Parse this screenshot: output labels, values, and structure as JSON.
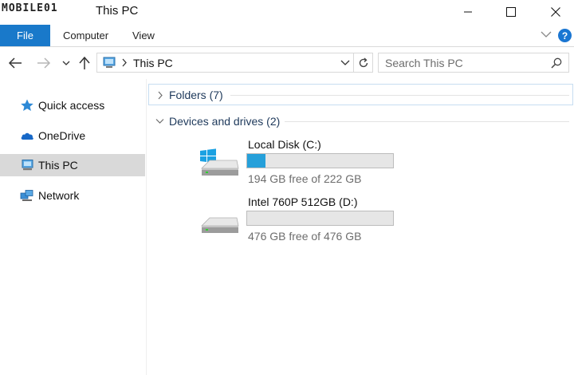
{
  "window": {
    "watermark": "MOBILE01",
    "title": "This PC"
  },
  "ribbon": {
    "tabs": [
      {
        "label": "File"
      },
      {
        "label": "Computer"
      },
      {
        "label": "View"
      }
    ],
    "help_label": "?"
  },
  "navigation": {
    "address_location": "This PC",
    "search_placeholder": "Search This PC"
  },
  "sidebar": {
    "items": [
      {
        "label": "Quick access",
        "icon": "star-icon",
        "selected": false
      },
      {
        "label": "OneDrive",
        "icon": "cloud-icon",
        "selected": false
      },
      {
        "label": "This PC",
        "icon": "computer-icon",
        "selected": true
      },
      {
        "label": "Network",
        "icon": "network-icon",
        "selected": false
      }
    ]
  },
  "content": {
    "folders_group": {
      "label": "Folders (7)",
      "expanded": false
    },
    "devices_group": {
      "label": "Devices and drives (2)",
      "expanded": true
    },
    "drives": [
      {
        "name": "Local Disk (C:)",
        "free_text": "194 GB free of 222 GB",
        "used_fraction": 0.126,
        "icon": "windows-drive-icon"
      },
      {
        "name": "Intel 760P 512GB (D:)",
        "free_text": "476 GB free of 476 GB",
        "used_fraction": 0.0,
        "icon": "drive-icon"
      }
    ]
  },
  "colors": {
    "accent": "#1979ca",
    "usage_bar": "#26a0da",
    "selected_item": "#d9d9d9",
    "group_header": "#1e395b"
  }
}
